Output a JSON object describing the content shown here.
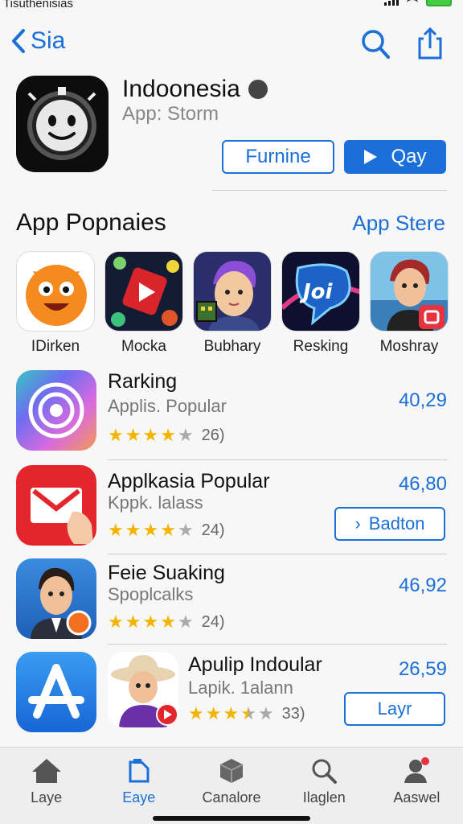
{
  "status": {
    "carrier": "Tisuthenisias"
  },
  "nav": {
    "back_label": "Sia"
  },
  "hero": {
    "title": "Indoonesia",
    "subtitle": "App: Storm",
    "outline_btn": "Furnine",
    "primary_btn": "Qay"
  },
  "section": {
    "title": "App Popnaies",
    "link": "App Stere"
  },
  "featured": [
    {
      "label": "IDirken"
    },
    {
      "label": "Mocka"
    },
    {
      "label": "Bubhary"
    },
    {
      "label": "Resking"
    },
    {
      "label": "Moshray"
    }
  ],
  "featured_text": {
    "joi": "Joi"
  },
  "list": [
    {
      "title": "Rarking",
      "subtitle": "Applis. Popular",
      "stars": 4,
      "count": "26)",
      "price": "40,29"
    },
    {
      "title": "Applkasia Popular",
      "subtitle": "Kppk. lalass",
      "stars": 4,
      "count": "24)",
      "price": "46,80",
      "button": "Badton"
    },
    {
      "title": "Feie Suaking",
      "subtitle": "Spoplcalks",
      "stars": 4,
      "count": "24)",
      "price": "46,92"
    },
    {
      "title": "Apulip Indoular",
      "subtitle": "Lapik. 1alann",
      "stars": 3.5,
      "count": "33)",
      "price": "26,59",
      "button": "Layr"
    }
  ],
  "tabs": [
    {
      "label": "Laye",
      "icon": "home-icon"
    },
    {
      "label": "Eaye",
      "icon": "apps-icon",
      "active": true
    },
    {
      "label": "Canalore",
      "icon": "cube-icon"
    },
    {
      "label": "Ilaglen",
      "icon": "search-icon"
    },
    {
      "label": "Aaswel",
      "icon": "person-icon"
    }
  ],
  "colors": {
    "accent": "#1a6fd8",
    "star": "#f3b400"
  }
}
